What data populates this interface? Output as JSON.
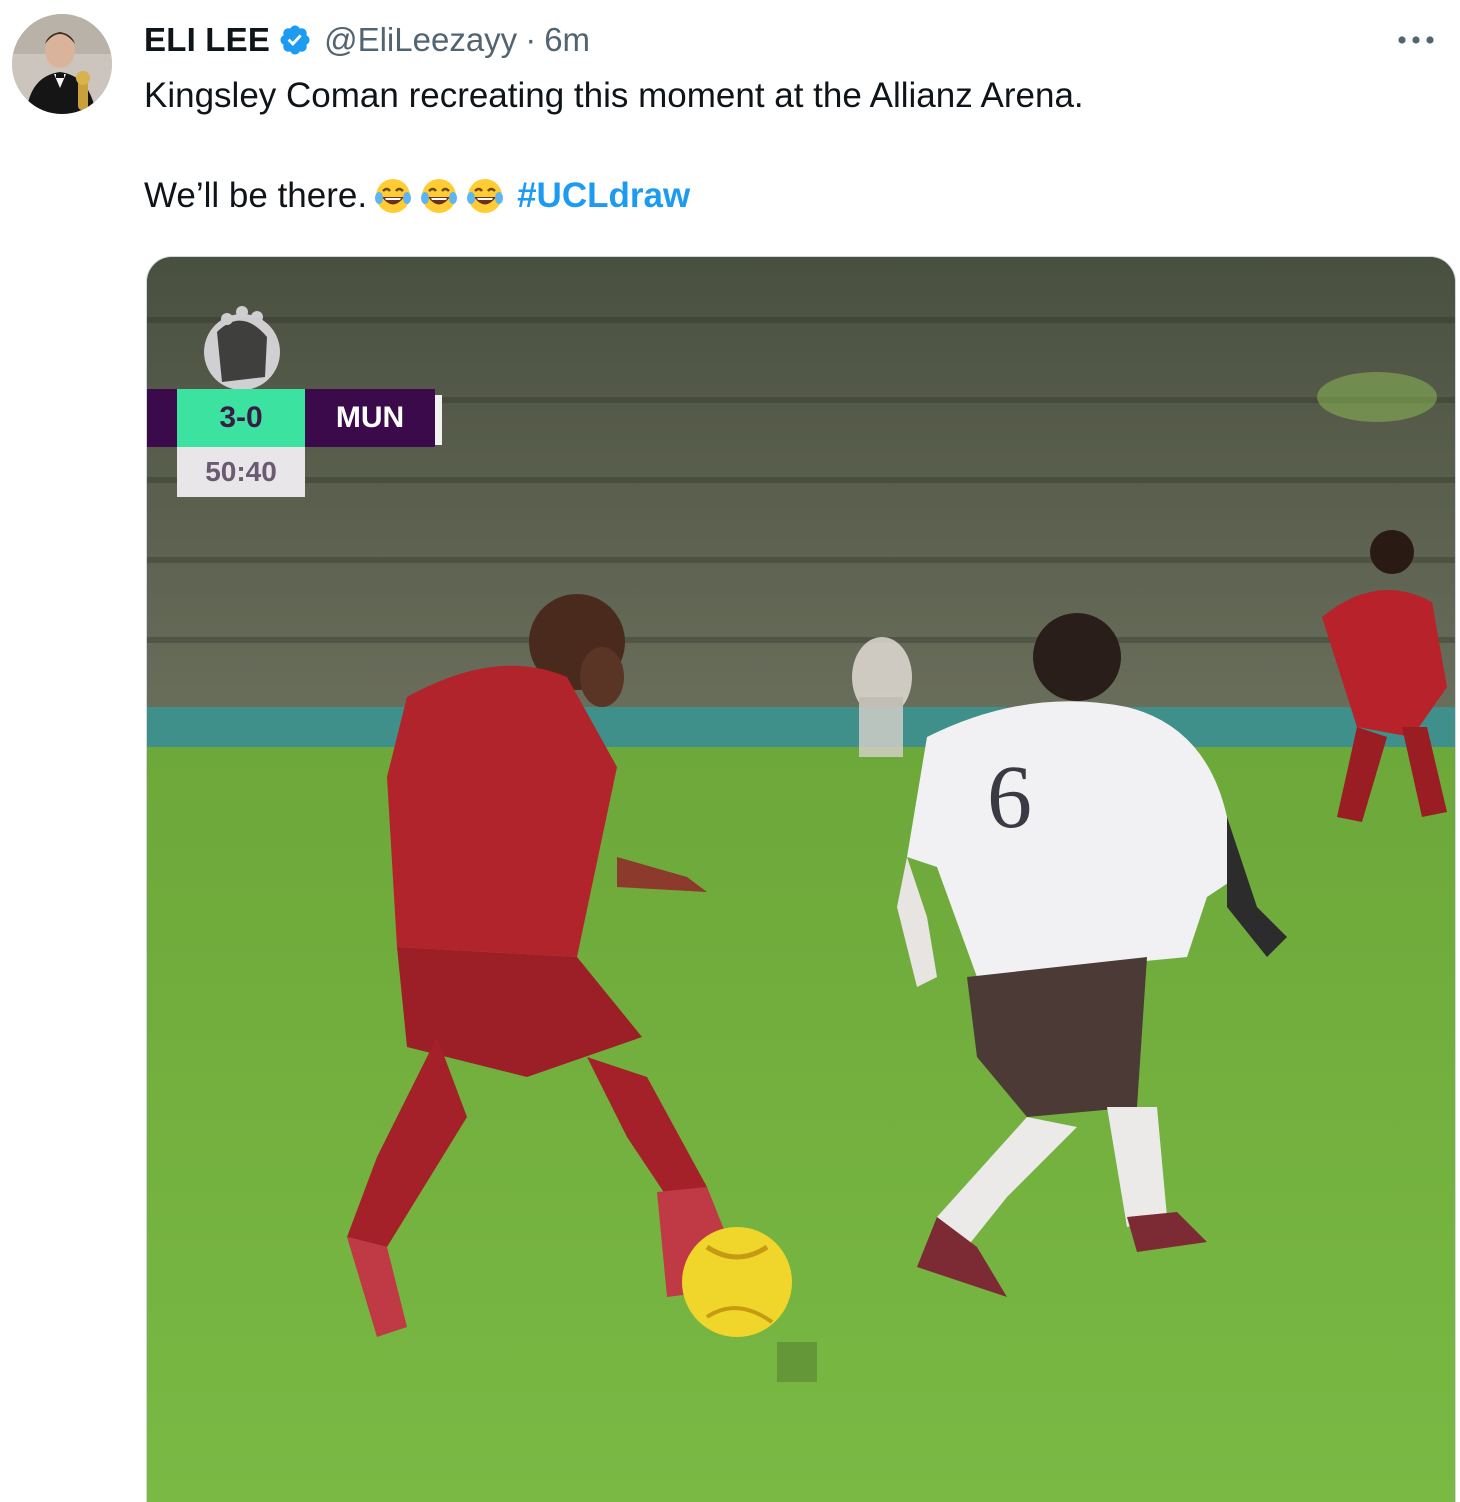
{
  "tweet": {
    "author_name": "ELI LEE",
    "handle": "@EliLeezayy",
    "separator": "·",
    "time": "6m",
    "text_line1": "Kingsley Coman recreating this moment at the Allianz Arena.",
    "text_line2": "We’ll be there.",
    "hashtag": "#UCLdraw",
    "icons": [
      "verified-badge-icon",
      "more-options-icon",
      "tears-of-joy-emoji"
    ],
    "accent_color": "#1d9bf0"
  },
  "media": {
    "scoreboard": {
      "score": "3-0",
      "team": "MUN",
      "clock": "50:40"
    },
    "player_number": "6"
  }
}
